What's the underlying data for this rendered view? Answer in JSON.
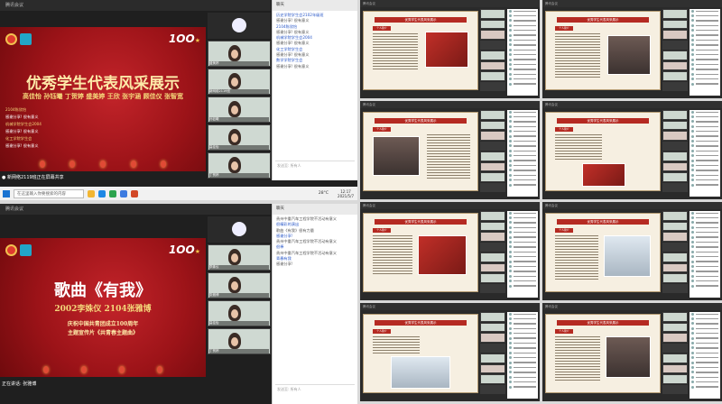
{
  "top_shot": {
    "window_title": "腾讯会议",
    "slide_title": "优秀学生代表风采展示",
    "names": "高佳怡 孙钰曦 丁贺婷 盛美婷 王欣 张宇涵 顾佳仪 张智宽",
    "caption": "● 新网络2119班正在屏幕共享",
    "search_placeholder": "在这里输入你要搜索的内容",
    "clock_time": "12:17",
    "clock_date": "2021/5/7",
    "temperature": "28°C",
    "chat_title": "聊天",
    "chat_to": "发送至: 所有人",
    "chat_lines": [
      "历史学院学生会2102年级班",
      "感谢分享! 很有意义",
      "2104陈欣怡",
      "感谢分享! 很有意义",
      "机械学院学生会2004",
      "感谢分享! 很有意义",
      "化工学院学生会",
      "感谢分享! 很有意义",
      "数学学院学生会",
      "感谢分享! 很有意义"
    ],
    "participants": [
      "主持人",
      "盛美婷",
      "新网络2119班",
      "孙钰曦",
      "高佳怡",
      "丁贺婷"
    ]
  },
  "bottom_shot": {
    "window_title": "腾讯会议",
    "song_title": "歌曲《有我》",
    "performers": "2002李姝仪 2104张雅博",
    "sub1": "庆祝中国共青团成立100周年",
    "sub2": "主题宣传片《共青春主题曲》",
    "chat_title": "聊天",
    "chat_to": "发送至: 所有人",
    "chat_lines": [
      "贵州中重汽车工程学院不活动有意义",
      "很精彩的演出",
      "歌曲《有我》很有力量",
      "感谢分享!",
      "贵州中重汽车工程学院不活动有意义",
      "很棒",
      "贵州中重汽车工程学院不活动有意义",
      "青春有我",
      "感谢分享!"
    ],
    "participants": [
      "主持人",
      "李姝仪",
      "张雅博",
      "高佳怡",
      "丁贺婷"
    ],
    "caption": "正在讲话: 张雅博"
  },
  "grid_cells": [
    {
      "title": "腾讯会议",
      "banner": "优秀学生代表风采展示",
      "tag": "个人简介"
    },
    {
      "title": "腾讯会议",
      "banner": "优秀学生代表风采展示",
      "tag": "个人简介"
    },
    {
      "title": "腾讯会议",
      "banner": "优秀学生代表风采展示",
      "tag": "个人简介"
    },
    {
      "title": "腾讯会议",
      "banner": "优秀学生代表风采展示",
      "tag": "个人简介"
    },
    {
      "title": "腾讯会议",
      "banner": "优秀学生代表风采展示",
      "tag": "个人简介"
    },
    {
      "title": "腾讯会议",
      "banner": "优秀学生代表风采展示",
      "tag": "个人简介"
    },
    {
      "title": "腾讯会议",
      "banner": "优秀学生代表风采展示",
      "tag": "个人简介"
    },
    {
      "title": "腾讯会议",
      "banner": "优秀学生代表风采展示",
      "tag": "个人简介"
    }
  ],
  "colors": {
    "slide_red": "#9c1318",
    "gold": "#f4d77a",
    "paper": "#f6efe1"
  }
}
